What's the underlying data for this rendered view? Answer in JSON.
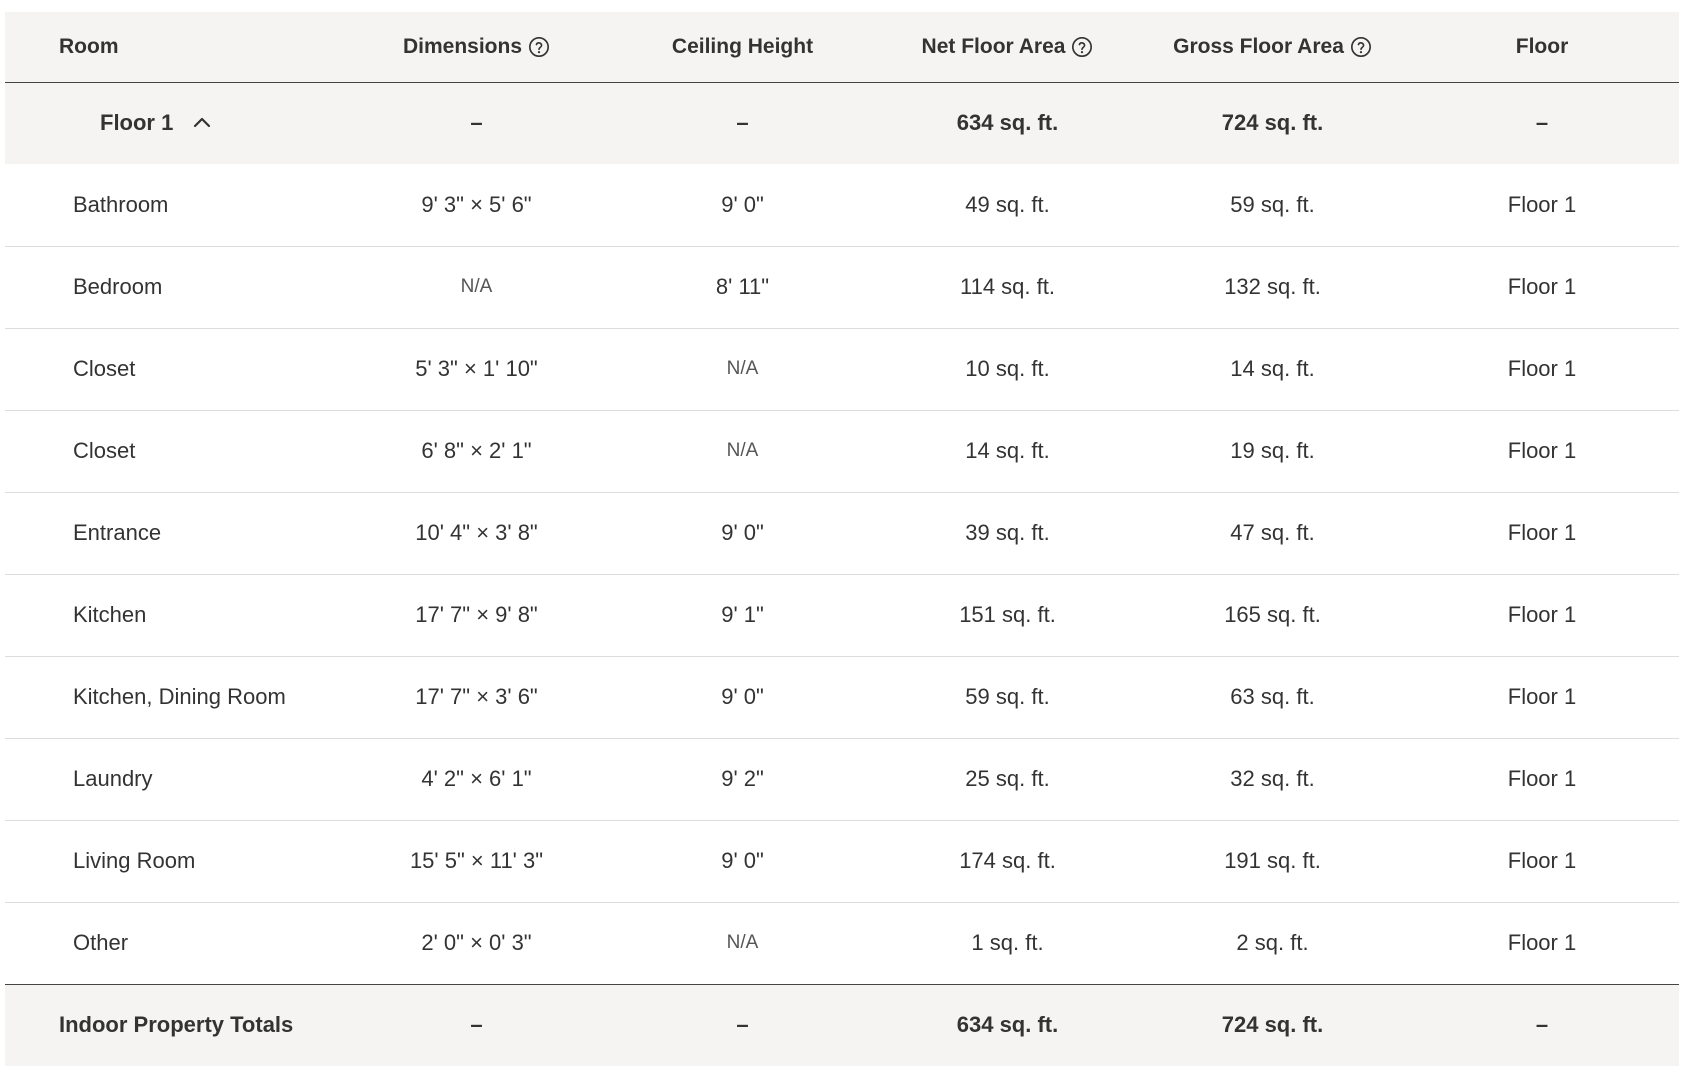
{
  "header": {
    "room": "Room",
    "dimensions": "Dimensions",
    "ceiling_height": "Ceiling Height",
    "net_floor_area": "Net Floor Area",
    "gross_floor_area": "Gross Floor Area",
    "floor": "Floor"
  },
  "icons": {
    "help": "help-circle-icon",
    "collapse": "chevron-up-icon"
  },
  "group": {
    "label": "Floor 1",
    "dimensions": "–",
    "ceiling_height": "–",
    "net_floor_area": "634 sq. ft.",
    "gross_floor_area": "724 sq. ft.",
    "floor": "–"
  },
  "rows": [
    {
      "room": "Bathroom",
      "dimensions": "9' 3\" × 5' 6\"",
      "ceiling_height": "9' 0\"",
      "net_floor_area": "49 sq. ft.",
      "gross_floor_area": "59 sq. ft.",
      "floor": "Floor 1"
    },
    {
      "room": "Bedroom",
      "dimensions": "N/A",
      "ceiling_height": "8' 11\"",
      "net_floor_area": "114 sq. ft.",
      "gross_floor_area": "132 sq. ft.",
      "floor": "Floor 1"
    },
    {
      "room": "Closet",
      "dimensions": "5' 3\" × 1' 10\"",
      "ceiling_height": "N/A",
      "net_floor_area": "10 sq. ft.",
      "gross_floor_area": "14 sq. ft.",
      "floor": "Floor 1"
    },
    {
      "room": "Closet",
      "dimensions": "6' 8\" × 2' 1\"",
      "ceiling_height": "N/A",
      "net_floor_area": "14 sq. ft.",
      "gross_floor_area": "19 sq. ft.",
      "floor": "Floor 1"
    },
    {
      "room": "Entrance",
      "dimensions": "10' 4\" × 3' 8\"",
      "ceiling_height": "9' 0\"",
      "net_floor_area": "39 sq. ft.",
      "gross_floor_area": "47 sq. ft.",
      "floor": "Floor 1"
    },
    {
      "room": "Kitchen",
      "dimensions": "17' 7\" × 9' 8\"",
      "ceiling_height": "9' 1\"",
      "net_floor_area": "151 sq. ft.",
      "gross_floor_area": "165 sq. ft.",
      "floor": "Floor 1"
    },
    {
      "room": "Kitchen, Dining Room",
      "dimensions": "17' 7\" × 3' 6\"",
      "ceiling_height": "9' 0\"",
      "net_floor_area": "59 sq. ft.",
      "gross_floor_area": "63 sq. ft.",
      "floor": "Floor 1"
    },
    {
      "room": "Laundry",
      "dimensions": "4' 2\" × 6' 1\"",
      "ceiling_height": "9' 2\"",
      "net_floor_area": "25 sq. ft.",
      "gross_floor_area": "32 sq. ft.",
      "floor": "Floor 1"
    },
    {
      "room": "Living Room",
      "dimensions": "15' 5\" × 11' 3\"",
      "ceiling_height": "9' 0\"",
      "net_floor_area": "174 sq. ft.",
      "gross_floor_area": "191 sq. ft.",
      "floor": "Floor 1"
    },
    {
      "room": "Other",
      "dimensions": "2' 0\" × 0' 3\"",
      "ceiling_height": "N/A",
      "net_floor_area": "1 sq. ft.",
      "gross_floor_area": "2 sq. ft.",
      "floor": "Floor 1"
    }
  ],
  "totals": {
    "label": "Indoor Property Totals",
    "dimensions": "–",
    "ceiling_height": "–",
    "net_floor_area": "634 sq. ft.",
    "gross_floor_area": "724 sq. ft.",
    "floor": "–"
  }
}
